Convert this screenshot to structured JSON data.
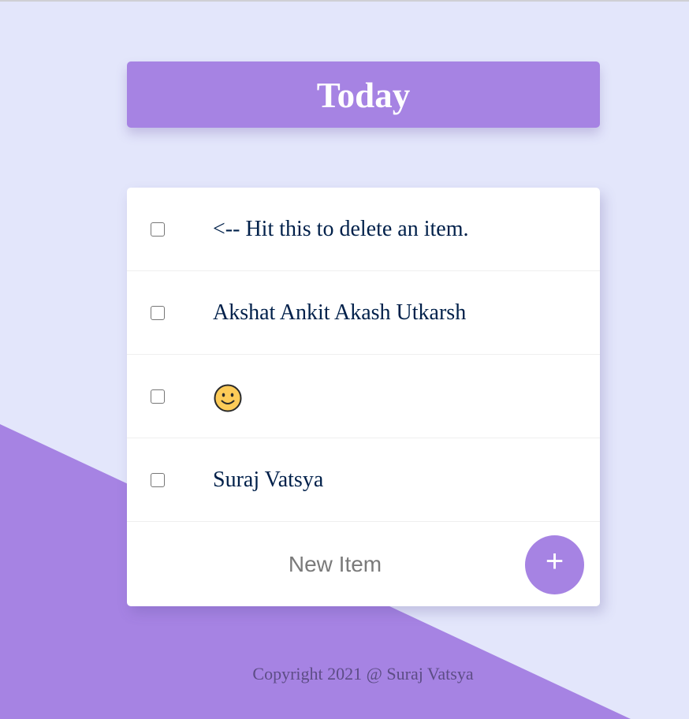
{
  "colors": {
    "page_background": "#e3e6fb",
    "accent": "#a683e3",
    "card_background": "#ffffff",
    "item_text": "#00204a",
    "footer_text": "#5d4d86"
  },
  "heading": {
    "title": "Today"
  },
  "todo": {
    "items": [
      {
        "text": "<-- Hit this to delete an item.",
        "checked": false
      },
      {
        "text": "Akshat Ankit Akash Utkarsh",
        "checked": false
      },
      {
        "text": "",
        "icon": "slightly-smiling-face-emoji",
        "checked": false
      },
      {
        "text": "Suraj Vatsya",
        "checked": false
      }
    ],
    "new_item": {
      "placeholder": "New Item",
      "value": ""
    },
    "add_button": {
      "label": "+",
      "icon": "plus-icon"
    }
  },
  "footer": {
    "text": "Copyright 2021 @ Suraj Vatsya"
  }
}
